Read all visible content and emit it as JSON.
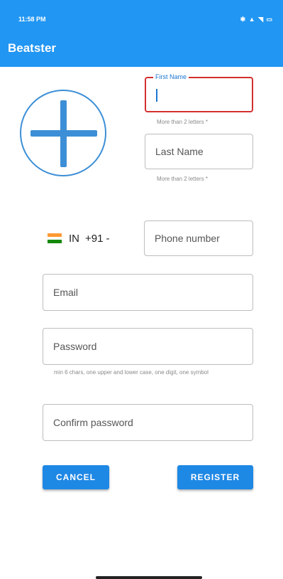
{
  "status_bar": {
    "time": "11:58 PM",
    "right_icons": "✱ ▲ ◥ ▭"
  },
  "app_bar": {
    "title": "Beatster"
  },
  "avatar": {
    "icon": "plus-icon"
  },
  "first_name": {
    "label": "First Name",
    "helper": "More than 2 letters *"
  },
  "last_name": {
    "placeholder": "Last Name",
    "helper": "More than 2 letters *"
  },
  "phone": {
    "country_code": "IN",
    "dial_code": "+91",
    "placeholder": "Phone number"
  },
  "email": {
    "placeholder": "Email"
  },
  "password": {
    "placeholder": "Password",
    "helper": "min 6 chars, one upper and lower case, one digit, one symbol"
  },
  "confirm_password": {
    "placeholder": "Confirm password"
  },
  "buttons": {
    "cancel": "CANCEL",
    "register": "REGISTER"
  },
  "colors": {
    "primary": "#2196f3",
    "button": "#1e88e5",
    "error": "#d32f2f"
  }
}
